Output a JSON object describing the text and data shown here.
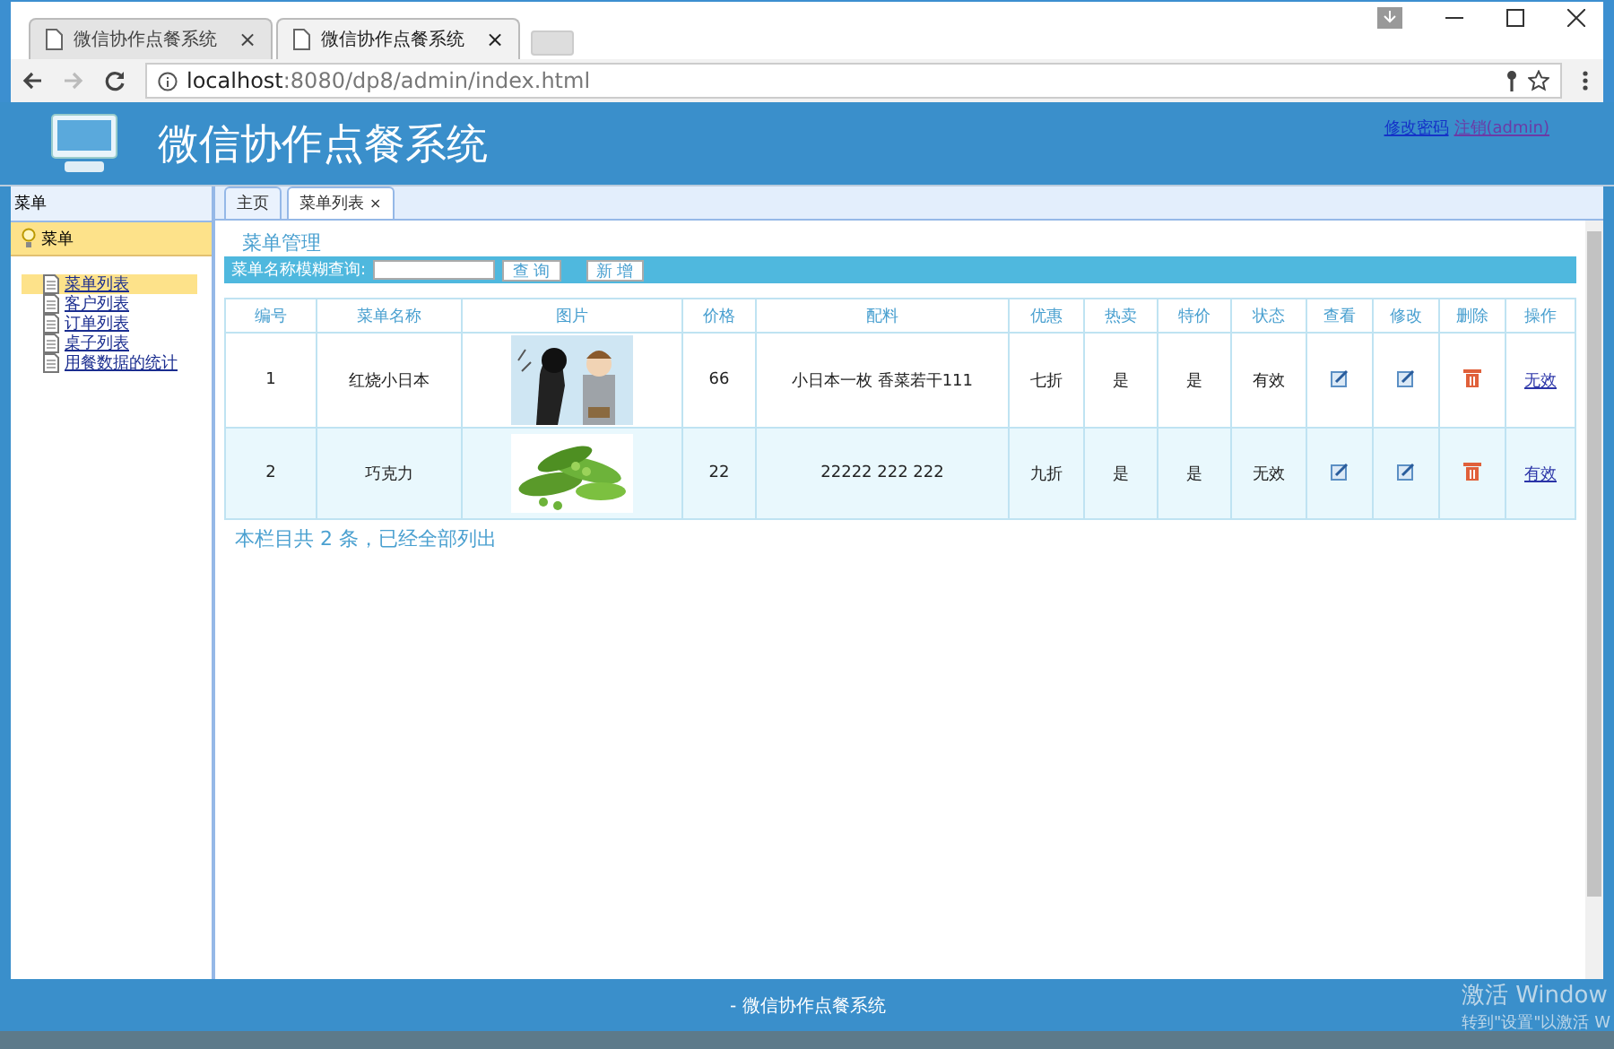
{
  "browser": {
    "tabs": [
      {
        "title": "微信协作点餐系统",
        "selected": false,
        "close": "×"
      },
      {
        "title": "微信协作点餐系统",
        "selected": true,
        "close": "×"
      }
    ],
    "url_host": "localhost",
    "url_rest": ":8080/dp8/admin/index.html"
  },
  "header": {
    "title": "微信协作点餐系统",
    "links": [
      "修改密码",
      "注销(admin)"
    ]
  },
  "sidebar": {
    "title": "菜单",
    "group": "菜单",
    "items": [
      {
        "label": "菜单列表",
        "selected": true
      },
      {
        "label": "客户列表",
        "selected": false
      },
      {
        "label": "订单列表",
        "selected": false
      },
      {
        "label": "桌子列表",
        "selected": false
      },
      {
        "label": "用餐数据的统计",
        "selected": false
      }
    ]
  },
  "content_tabs": [
    {
      "label": "主页",
      "selected": false
    },
    {
      "label": "菜单列表",
      "selected": true,
      "close": "×"
    }
  ],
  "section_title": "菜单管理",
  "search": {
    "label": "菜单名称模糊查询:",
    "buttons": [
      "查 询",
      "新 增"
    ]
  },
  "table": {
    "columns": [
      "编号",
      "菜单名称",
      "图片",
      "价格",
      "配料",
      "优惠",
      "热卖",
      "特价",
      "状态",
      "查看",
      "修改",
      "删除",
      "操作"
    ],
    "rows": [
      {
        "hovered": false,
        "id": "1",
        "name": "红烧小日本",
        "picture": {
          "kind": "people"
        },
        "price": "66",
        "ingredients": "小日本一枚 香菜若干111",
        "discount": "七折",
        "hot": "是",
        "special": "是",
        "status": "有效",
        "action": "无效"
      },
      {
        "hovered": true,
        "id": "2",
        "name": "巧克力",
        "picture": {
          "kind": "peas"
        },
        "price": "22",
        "ingredients": "22222 222 222",
        "discount": "九折",
        "hot": "是",
        "special": "是",
        "status": "无效",
        "action": "有效"
      }
    ]
  },
  "summary": "本栏目共 2 条，已经全部列出",
  "footer": "- 微信协作点餐系统",
  "windows_notice": [
    "激活 Window",
    "转到\"设置\"以激活 W"
  ]
}
